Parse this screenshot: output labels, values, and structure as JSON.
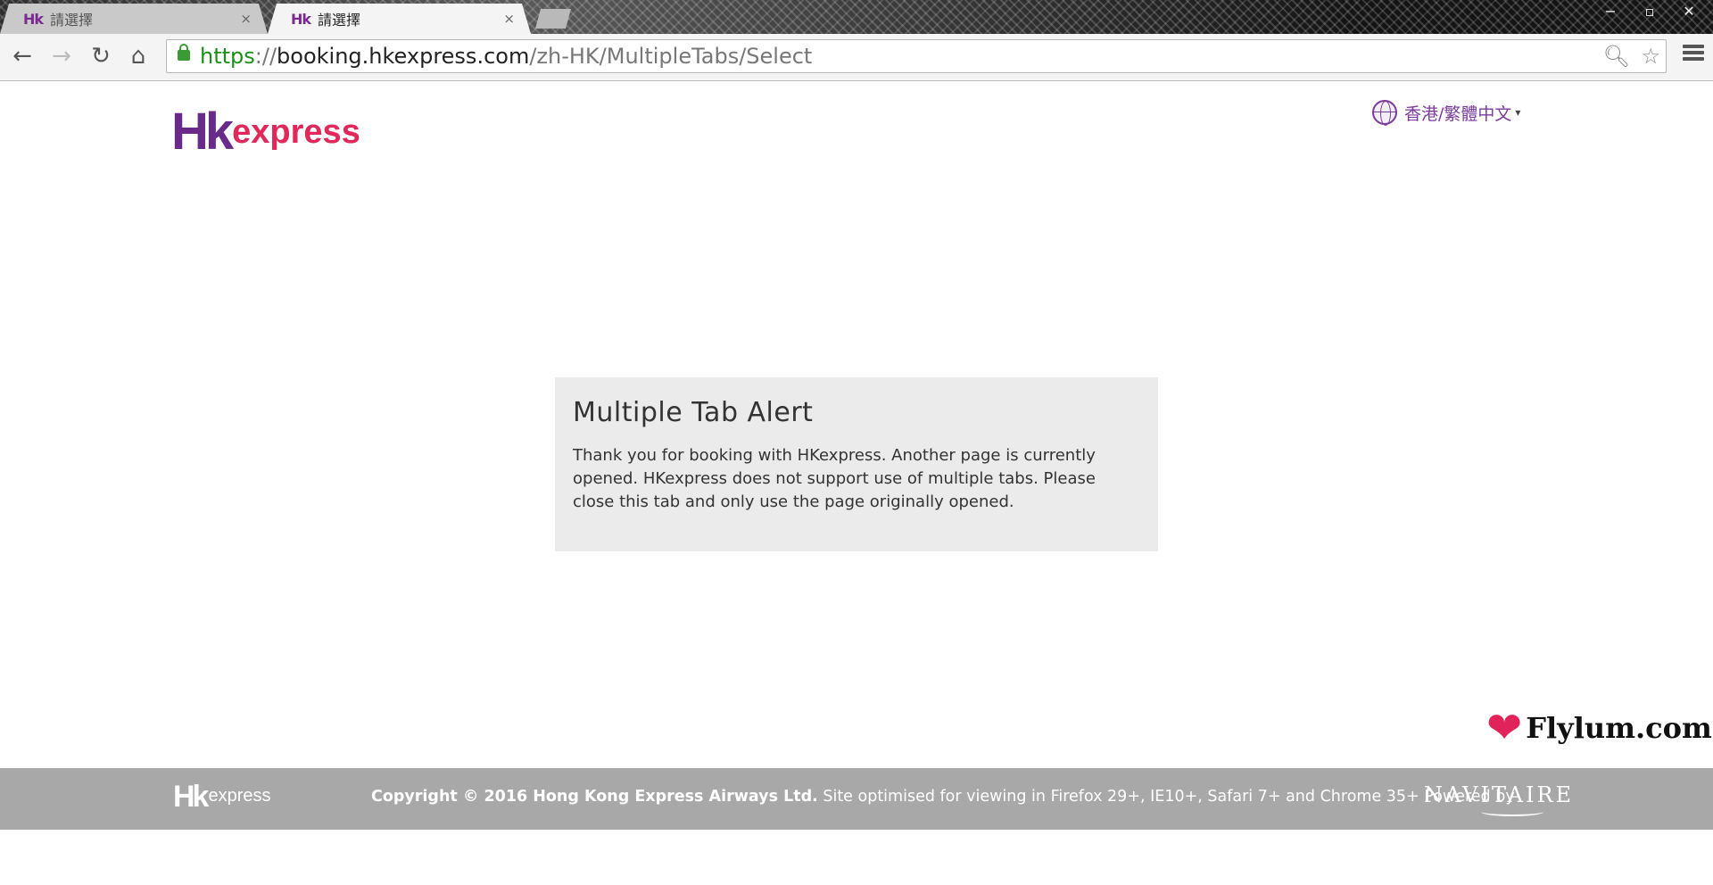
{
  "browser": {
    "tabs": [
      {
        "favicon": "Hk",
        "title": "請選擇",
        "close": "×",
        "active": false
      },
      {
        "favicon": "Hk",
        "title": "請選擇",
        "close": "×",
        "active": true
      }
    ],
    "window_controls": {
      "minimize": "−",
      "restore": "▫",
      "close": "✕"
    },
    "nav": {
      "back": "←",
      "forward": "→",
      "reload": "↻",
      "home": "⌂"
    },
    "url": {
      "scheme": "https",
      "sep": "://",
      "host": "booking.hkexpress.com",
      "path": "/zh-HK/MultipleTabs/Select"
    },
    "icons": {
      "zoom": "🔍︎",
      "star": "☆"
    }
  },
  "header": {
    "logo": {
      "hk": "Hk",
      "express": "express"
    },
    "language": {
      "label": "香港/繁體中文",
      "caret": "▾"
    }
  },
  "alert": {
    "title": "Multiple Tab Alert",
    "body": "Thank you for booking with HKexpress. Another page is currently opened. HKexpress does not support use of multiple tabs. Please close this tab and only use the page originally opened."
  },
  "watermark": {
    "heart": "❤",
    "text": "Flylum.com"
  },
  "footer": {
    "logo": {
      "hk": "Hk",
      "express": "express"
    },
    "copyright": "Copyright © 2016 Hong Kong Express Airways Ltd.",
    "support": " Site optimised for viewing in Firefox 29+, IE10+, Safari 7+ and Chrome 35+ Powered by",
    "powered_logo": "NAVITAIRE"
  },
  "colors": {
    "brand_purple": "#6a2a8a",
    "brand_red": "#e0295a",
    "footer_bg": "#a8a8a8",
    "alert_bg": "#ebebeb"
  }
}
